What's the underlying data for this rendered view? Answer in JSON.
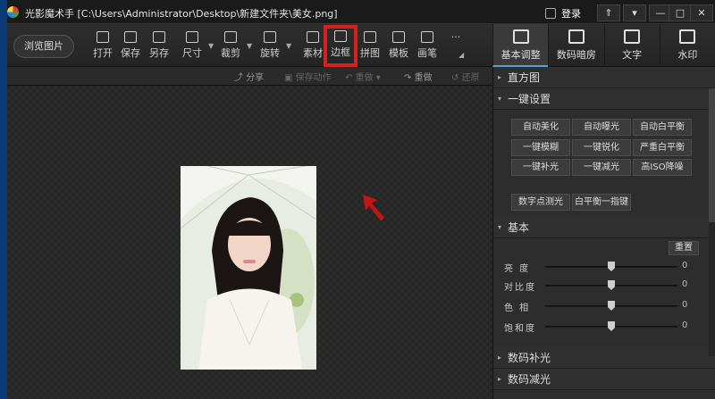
{
  "window": {
    "title": "光影魔术手 [C:\\Users\\Administrator\\Desktop\\新建文件夹\\美女.png]",
    "login": "登录",
    "btns": [
      "⇑",
      "▾",
      "—",
      "□",
      "✕"
    ]
  },
  "toolbar": {
    "browse": "浏览图片",
    "tools": [
      "打开",
      "保存",
      "另存",
      "尺寸",
      "裁剪",
      "旋转",
      "素材",
      "边框",
      "拼图",
      "模板",
      "画笔",
      "···"
    ]
  },
  "tabs": [
    "基本调整",
    "数码暗房",
    "文字",
    "水印"
  ],
  "subbar": {
    "share": "分享",
    "save_action": "保存动作",
    "undo": "重做",
    "redo_left": "重做",
    "redo": "还原"
  },
  "panel": {
    "histogram": "直方图",
    "oneclick": "一键设置",
    "presets": [
      "自动美化",
      "自动曝光",
      "自动白平衡",
      "一键模糊",
      "一键锐化",
      "严重白平衡",
      "一键补光",
      "一键减光",
      "高ISO降噪",
      "数字点测光",
      "白平衡一指键"
    ],
    "basic": "基本",
    "reset": "重置",
    "sliders": [
      {
        "name": "亮  度",
        "value": "0"
      },
      {
        "name": "对比度",
        "value": "0"
      },
      {
        "name": "色  相",
        "value": "0"
      },
      {
        "name": "饱和度",
        "value": "0"
      }
    ],
    "more": [
      "数码补光",
      "数码减光"
    ]
  }
}
